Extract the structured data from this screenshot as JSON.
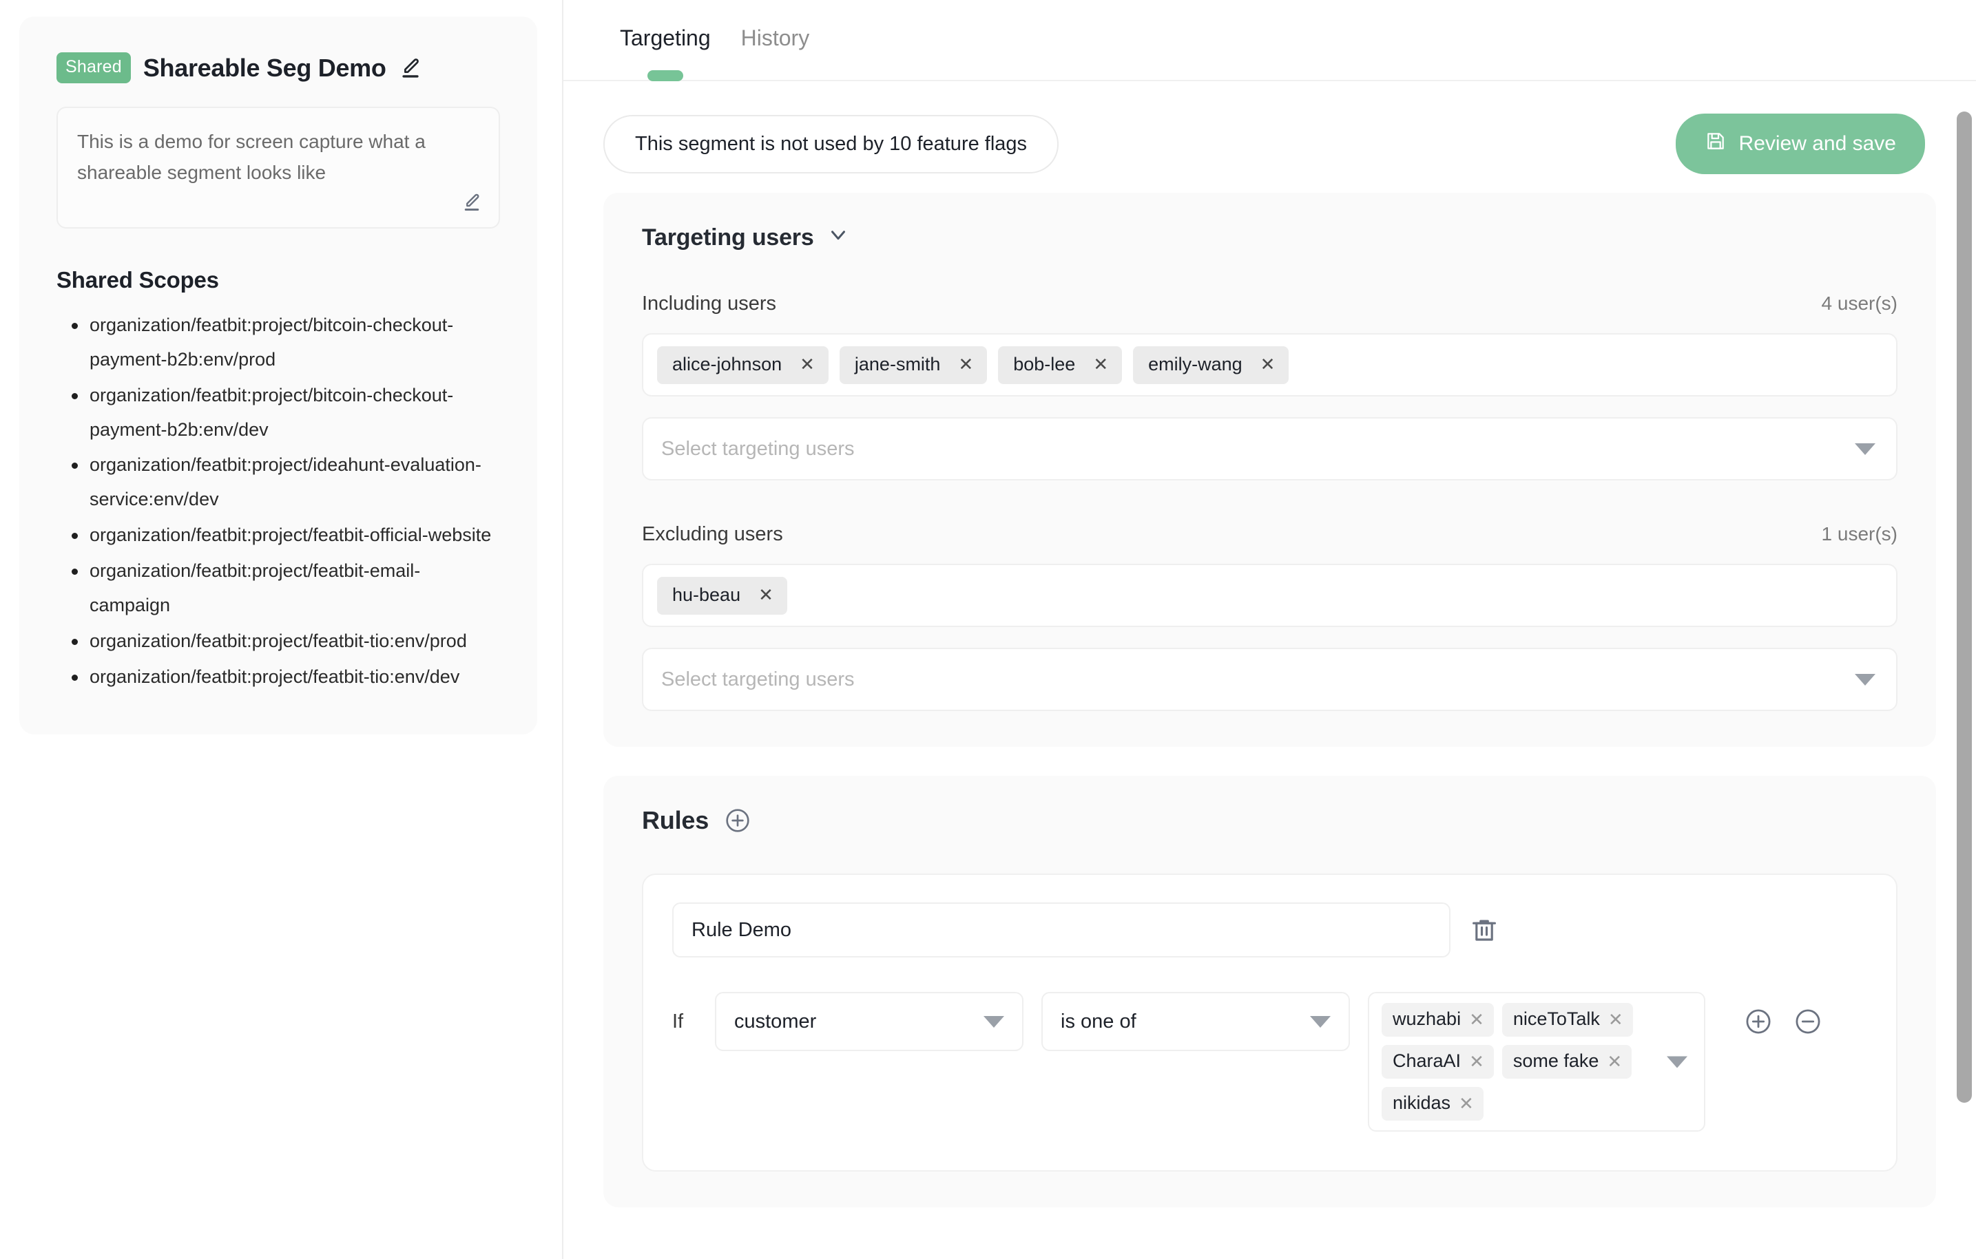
{
  "segment": {
    "badge": "Shared",
    "name": "Shareable Seg Demo",
    "description": "This is a demo for screen capture what a shareable segment looks like",
    "scopes_title": "Shared Scopes",
    "scopes": [
      "organization/featbit:project/bitcoin-checkout-payment-b2b:env/prod",
      "organization/featbit:project/bitcoin-checkout-payment-b2b:env/dev",
      "organization/featbit:project/ideahunt-evaluation-service:env/dev",
      "organization/featbit:project/featbit-official-website",
      "organization/featbit:project/featbit-email-campaign",
      "organization/featbit:project/featbit-tio:env/prod",
      "organization/featbit:project/featbit-tio:env/dev"
    ]
  },
  "tabs": [
    {
      "label": "Targeting",
      "active": true
    },
    {
      "label": "History",
      "active": false
    }
  ],
  "toolbar": {
    "usage_notice": "This segment is not used by 10 feature flags",
    "save_label": "Review and save"
  },
  "targeting": {
    "section_title": "Targeting users",
    "including": {
      "label": "Including users",
      "count": "4 user(s)",
      "users": [
        "alice-johnson",
        "jane-smith",
        "bob-lee",
        "emily-wang"
      ],
      "placeholder": "Select targeting users"
    },
    "excluding": {
      "label": "Excluding users",
      "count": "1 user(s)",
      "users": [
        "hu-beau"
      ],
      "placeholder": "Select targeting users"
    }
  },
  "rules": {
    "title": "Rules",
    "items": [
      {
        "name": "Rule Demo",
        "if_label": "If",
        "property": "customer",
        "operator": "is one of",
        "values": [
          "wuzhabi",
          "niceToTalk",
          "CharaAI",
          "some fake",
          "nikidas"
        ]
      }
    ]
  },
  "colors": {
    "accent_green": "#7cc49b",
    "badge_green": "#6cbb8b",
    "tab_indicator": "#77c497",
    "card_bg": "#fafafa",
    "tag_bg": "#ebebeb"
  },
  "icons": {
    "edit_name": "pencil-icon",
    "edit_description": "pencil-icon",
    "save": "floppy-disk-icon",
    "collapse": "chevron-down-icon",
    "add_rule": "plus-circle-icon",
    "delete_rule": "trash-icon",
    "add_condition": "plus-circle-icon",
    "remove_condition": "minus-circle-icon",
    "dropdown": "caret-down-icon",
    "remove_tag": "close-icon"
  }
}
